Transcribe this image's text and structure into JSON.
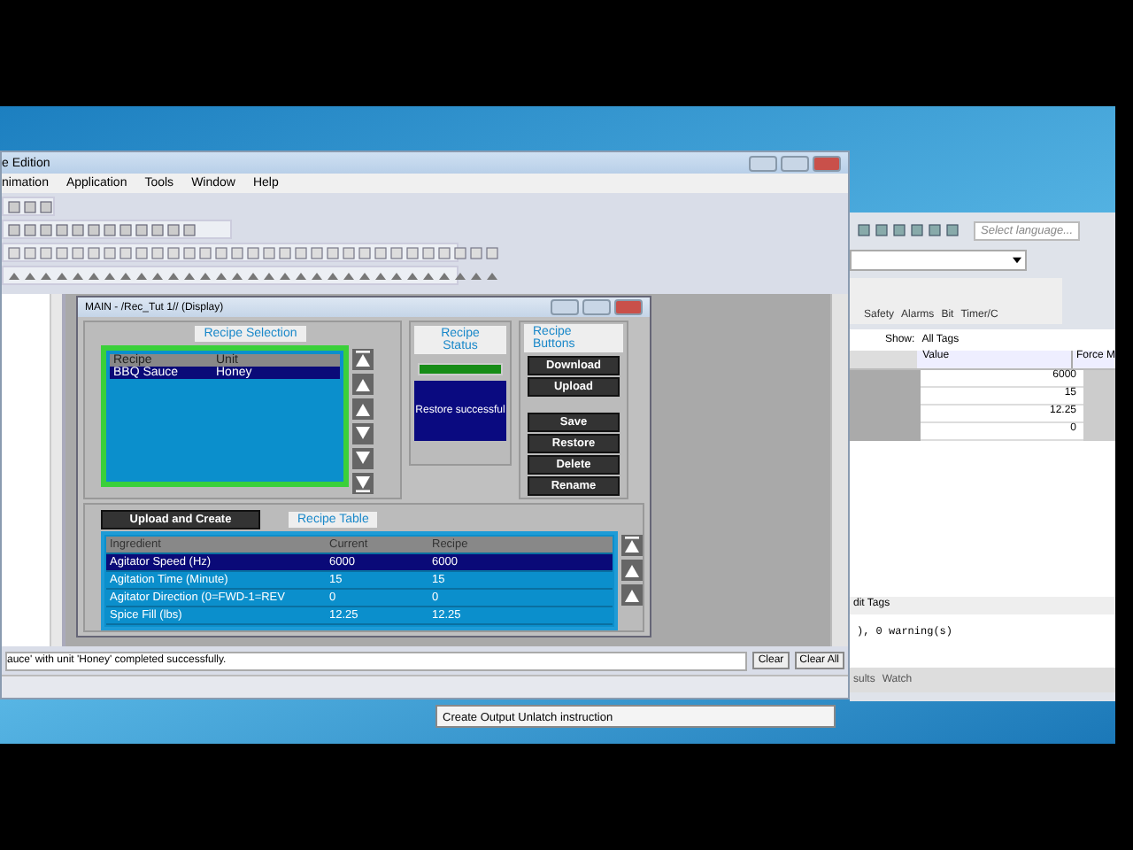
{
  "main_window": {
    "title": "e Edition",
    "menu": [
      "nimation",
      "Application",
      "Tools",
      "Window",
      "Help"
    ],
    "display": {
      "title": "MAIN - /Rec_Tut 1// (Display)",
      "recipe_selection": {
        "label": "Recipe Selection",
        "columns": [
          "Recipe",
          "Unit"
        ],
        "rows": [
          {
            "cells": [
              "BBQ Sauce",
              "Honey"
            ],
            "selected": true
          }
        ]
      },
      "recipe_status": {
        "label": "Recipe Status",
        "message": "Restore successful"
      },
      "recipe_buttons": {
        "label": "Recipe Buttons",
        "top": [
          "Download",
          "Upload"
        ],
        "bottom": [
          "Save",
          "Restore",
          "Delete",
          "Rename"
        ]
      },
      "upload_button": "Upload and Create",
      "recipe_table": {
        "label": "Recipe Table",
        "columns": [
          "Ingredient",
          "Current",
          "Recipe"
        ],
        "rows": [
          {
            "cells": [
              "Agitator Speed (Hz)",
              "6000",
              "6000"
            ],
            "selected": true
          },
          {
            "cells": [
              "Agitation Time (Minute)",
              "15",
              "15"
            ],
            "selected": false
          },
          {
            "cells": [
              "Agitator Direction (0=FWD-1=REV",
              "0",
              "0"
            ],
            "selected": false
          },
          {
            "cells": [
              "Spice Fill (lbs)",
              "12.25",
              "12.25"
            ],
            "selected": false
          }
        ]
      }
    },
    "output": {
      "message": "auce' with unit 'Honey' completed successfully.",
      "buttons": [
        "Clear",
        "Clear All"
      ]
    }
  },
  "back_window": {
    "search": {
      "placeholder": "Select language..."
    },
    "tabs": [
      "Safety",
      "Alarms",
      "Bit",
      "Timer/C"
    ],
    "show_label": "Show:",
    "show_value": "All Tags",
    "columns": [
      "Value",
      "Force M"
    ],
    "values": [
      "6000",
      "15",
      "12.25",
      "0"
    ],
    "edit_tab": "dit Tags",
    "message": "), 0 warning(s)",
    "bottom_tabs": [
      "sults",
      "Watch"
    ]
  },
  "tooltip": "Create Output Unlatch instruction"
}
